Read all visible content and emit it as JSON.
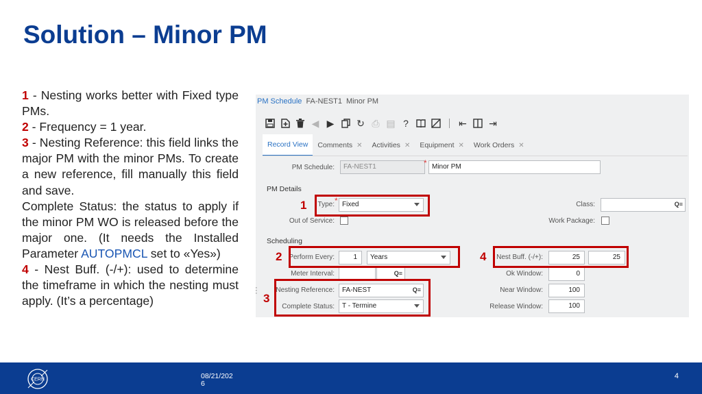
{
  "slide": {
    "title": "Solution – Minor PM",
    "footer_date": "08/21/2026",
    "page_number": "4"
  },
  "bullets": {
    "b1_num": "1",
    "b1_text": " - Nesting works better with Fixed type PMs.",
    "b2_num": "2",
    "b2_text": " - Frequency = 1 year.",
    "b3_num": "3",
    "b3_text": " - Nesting Reference: this field links the major PM with the minor PMs. To create a new reference, fill manually this field and save.",
    "complete_text_a": "Complete Status: the status to apply if the minor PM WO is released before the major one. (It needs the Installed Parameter ",
    "complete_link": "AUTOPMCL",
    "complete_text_b": " set to «Yes»)",
    "b4_num": "4",
    "b4_text": " - Nest Buff. (-/+): used to determine the timeframe in which the nesting must apply. (It’s a percentage)"
  },
  "app": {
    "breadcrumb": {
      "section": "PM Schedule",
      "code": "FA-NEST1",
      "desc": "Minor PM"
    },
    "toolbar_icons": [
      "save-icon",
      "new-record-icon",
      "delete-icon",
      "previous-icon",
      "next-icon",
      "copy-icon",
      "refresh-icon",
      "print-icon",
      "print-disabled-icon",
      "help-icon",
      "book-icon",
      "screen-config-icon",
      "first-record-icon",
      "panel-toggle-icon",
      "last-record-icon"
    ],
    "tabs": [
      {
        "label": "Record View"
      },
      {
        "label": "Comments"
      },
      {
        "label": "Activities"
      },
      {
        "label": "Equipment"
      },
      {
        "label": "Work Orders"
      }
    ],
    "form": {
      "pm_schedule_label": "PM Schedule:",
      "pm_schedule_value": "FA-NEST1",
      "pm_desc_value": "Minor PM",
      "pm_details_heading": "PM Details",
      "type_label": "Type:",
      "type_value": "Fixed",
      "class_label": "Class:",
      "class_value": "",
      "oos_label": "Out of Service:",
      "workpkg_label": "Work Package:",
      "scheduling_heading": "Scheduling",
      "perform_every_label": "Perform Every:",
      "perform_every_value": "1",
      "perform_unit_value": "Years",
      "nest_buff_label": "Nest Buff. (-/+):",
      "nest_buff_minus": "25",
      "nest_buff_plus": "25",
      "meter_interval_label": "Meter Interval:",
      "ok_window_label": "Ok Window:",
      "ok_window_value": "0",
      "nesting_ref_label": "Nesting Reference:",
      "nesting_ref_value": "FA-NEST",
      "near_window_label": "Near Window:",
      "near_window_value": "100",
      "complete_status_label": "Complete Status:",
      "complete_status_value": "T - Termine",
      "release_window_label": "Release Window:",
      "release_window_value": "100"
    },
    "highlight_numbers": [
      "1",
      "2",
      "3",
      "4"
    ],
    "highlight_color": "#c00000"
  },
  "colors": {
    "title": "#0b3d91",
    "footer_bg": "#0b3d91",
    "accent_red": "#c00000",
    "link_blue": "#1a56b3"
  }
}
